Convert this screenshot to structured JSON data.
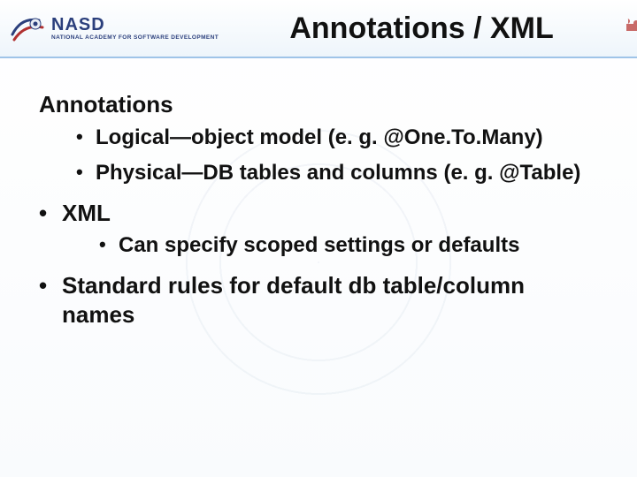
{
  "logo": {
    "main": "NASD",
    "sub": "NATIONAL ACADEMY FOR SOFTWARE DEVELOPMENT"
  },
  "title": "Annotations / XML",
  "content": {
    "items": [
      {
        "text": "Annotations",
        "bullet": false,
        "children": [
          "Logical—object model (e. g. @One.To.Many)",
          "Physical—DB tables and columns (e. g. @Table)"
        ]
      },
      {
        "text": "XML",
        "bullet": true,
        "children": [
          "Can specify scoped settings or defaults"
        ]
      },
      {
        "text": "Standard rules for default db table/column names",
        "bullet": true,
        "children": []
      }
    ]
  }
}
